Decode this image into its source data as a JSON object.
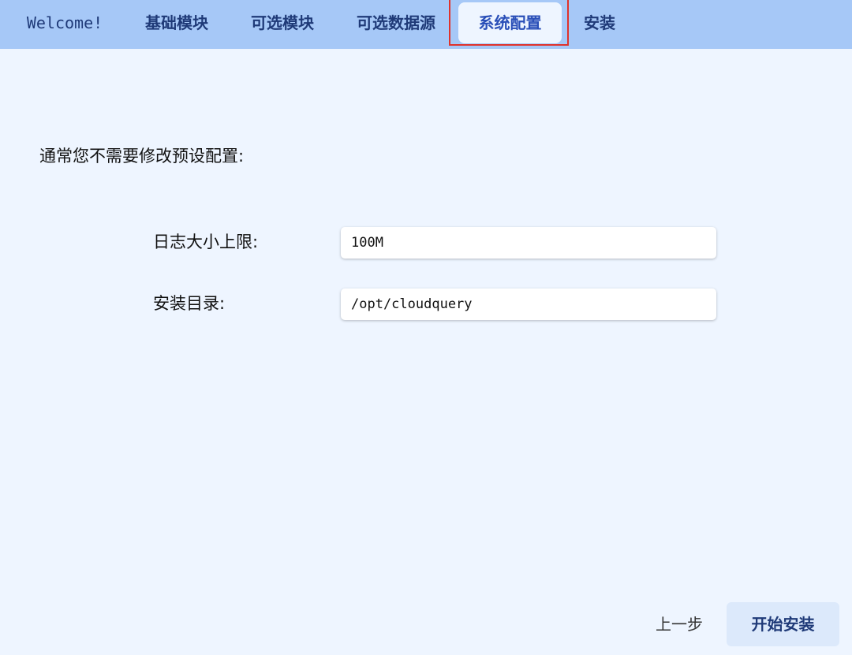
{
  "tabs": {
    "welcome": "Welcome!",
    "basic_modules": "基础模块",
    "optional_modules": "可选模块",
    "optional_datasources": "可选数据源",
    "system_config": "系统配置",
    "install": "安装"
  },
  "main": {
    "intro": "通常您不需要修改预设配置:",
    "log_size_label": "日志大小上限:",
    "log_size_value": "100M",
    "install_dir_label": "安装目录:",
    "install_dir_value": "/opt/cloudquery"
  },
  "footer": {
    "prev_label": "上一步",
    "start_label": "开始安装"
  },
  "colors": {
    "tabbar_bg": "#a6c8f7",
    "page_bg": "#eef5ff",
    "highlight": "#e0322b"
  }
}
